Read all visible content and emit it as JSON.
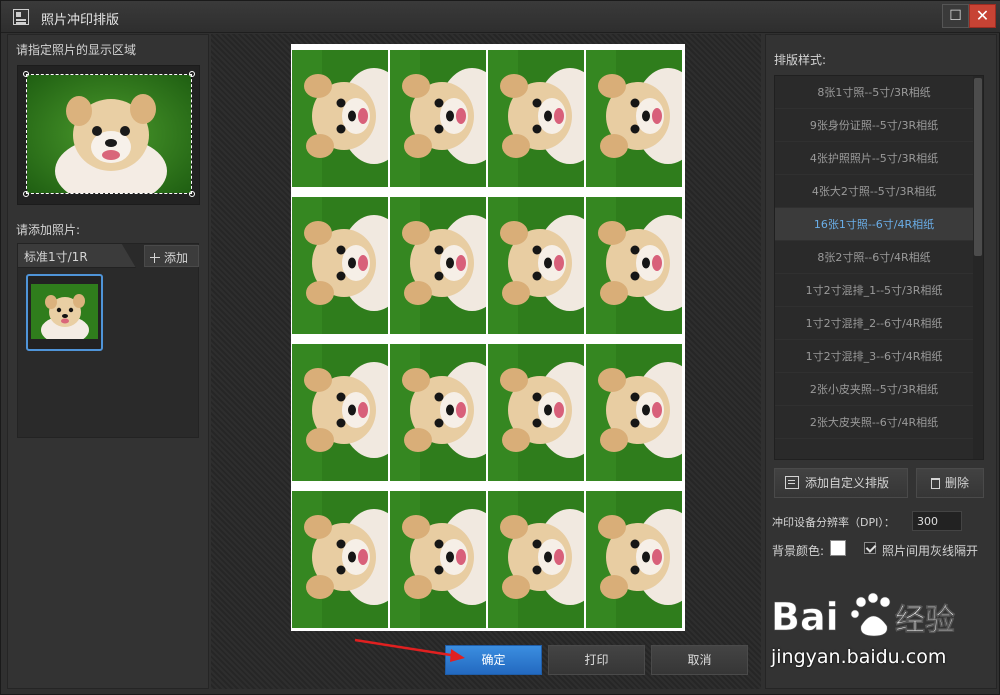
{
  "window": {
    "title": "照片冲印排版",
    "maximize_label": "☐",
    "close_label": "✕"
  },
  "left": {
    "area_label": "请指定照片的显示区域",
    "add_label": "请添加照片:",
    "tab_label": "标准1寸/1R",
    "add_button": "添加"
  },
  "center": {
    "ok": "确定",
    "print": "打印",
    "cancel": "取消"
  },
  "right": {
    "style_label": "排版样式:",
    "items": [
      {
        "label": "8张1寸照--5寸/3R相纸"
      },
      {
        "label": "9张身份证照--5寸/3R相纸"
      },
      {
        "label": "4张护照照片--5寸/3R相纸"
      },
      {
        "label": "4张大2寸照--5寸/3R相纸"
      },
      {
        "label": "16张1寸照--6寸/4R相纸"
      },
      {
        "label": "8张2寸照--6寸/4R相纸"
      },
      {
        "label": "1寸2寸混排_1--5寸/3R相纸"
      },
      {
        "label": "1寸2寸混排_2--6寸/4R相纸"
      },
      {
        "label": "1寸2寸混排_3--6寸/4R相纸"
      },
      {
        "label": "2张小皮夹照--5寸/3R相纸"
      },
      {
        "label": "2张大皮夹照--6寸/4R相纸"
      }
    ],
    "custom_button": "添加自定义排版",
    "delete_button": "删除",
    "dpi_label": "冲印设备分辨率（DPI）：",
    "dpi_value": "300",
    "bg_label": "背景颜色:",
    "gray_label": "照片间用灰线隔开"
  },
  "watermark": {
    "text": "jingyan.baidu.com"
  },
  "colors": {
    "accent": "#3b8ee0",
    "selected_text": "#6aaee8",
    "close": "#c74334"
  }
}
